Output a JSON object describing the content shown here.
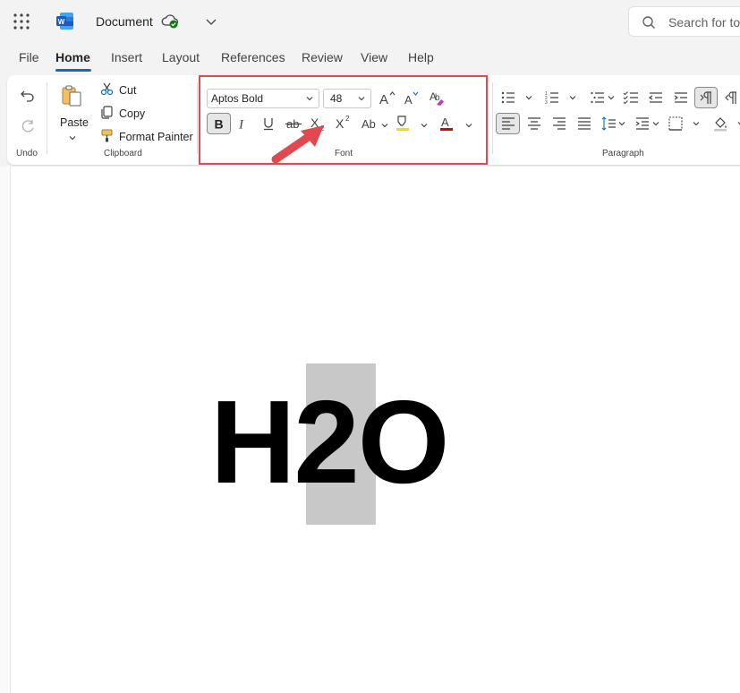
{
  "titlebar": {
    "doc_title": "Document",
    "search_placeholder": "Search for tools"
  },
  "tabs": [
    {
      "label": "File"
    },
    {
      "label": "Home"
    },
    {
      "label": "Insert"
    },
    {
      "label": "Layout"
    },
    {
      "label": "References"
    },
    {
      "label": "Review"
    },
    {
      "label": "View"
    },
    {
      "label": "Help"
    }
  ],
  "ribbon": {
    "undo": {
      "label": "Undo"
    },
    "clipboard": {
      "paste": "Paste",
      "cut": "Cut",
      "copy": "Copy",
      "format_painter": "Format Painter",
      "label": "Clipboard"
    },
    "font": {
      "font_name": "Aptos Bold",
      "font_size": "48",
      "label": "Font",
      "bold_pressed": true
    },
    "paragraph": {
      "label": "Paragraph"
    }
  },
  "document": {
    "text_before": "H",
    "text_selected": "2",
    "text_after": "O"
  },
  "colors": {
    "accent": "#0f6cbd",
    "annotation_red": "#e0494f",
    "font_color_bar": "#e00000",
    "highlight_bar": "#ffd800"
  }
}
